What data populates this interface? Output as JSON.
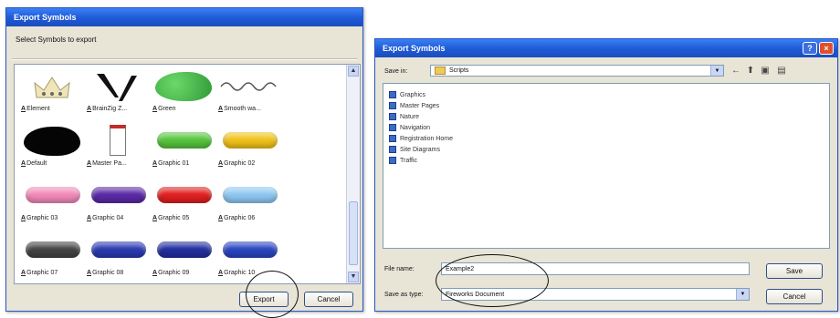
{
  "left_dialog": {
    "title": "Export Symbols",
    "subtitle": "Select Symbols to export",
    "symbols": [
      {
        "label": "Element",
        "thumb": "crown"
      },
      {
        "label": "BrainZig Z...",
        "thumb": "zigzag"
      },
      {
        "label": "Green",
        "thumb": "green-drop"
      },
      {
        "label": "Smooth wa...",
        "thumb": "smooth-wave"
      },
      {
        "label": "Default",
        "thumb": "black-drop"
      },
      {
        "label": "Master Pa...",
        "thumb": "master-page"
      },
      {
        "label": "Graphic 01",
        "thumb": "pill",
        "color": "#55c43c"
      },
      {
        "label": "Graphic 02",
        "thumb": "pill",
        "color": "#f0c21a"
      },
      {
        "label": "Graphic 03",
        "thumb": "pill",
        "color": "#f28ab8"
      },
      {
        "label": "Graphic 04",
        "thumb": "pill",
        "color": "#5a2aa6"
      },
      {
        "label": "Graphic 05",
        "thumb": "pill",
        "color": "#e02020"
      },
      {
        "label": "Graphic 06",
        "thumb": "pill",
        "color": "#8ec8f2"
      },
      {
        "label": "Graphic 07",
        "thumb": "pill",
        "color": "#444444"
      },
      {
        "label": "Graphic 08",
        "thumb": "pill",
        "color": "#2a3ab0"
      },
      {
        "label": "Graphic 09",
        "thumb": "pill",
        "color": "#23309e"
      },
      {
        "label": "Graphic 10",
        "thumb": "pill",
        "color": "#2a46c0"
      }
    ],
    "export_button": "Export",
    "cancel_button": "Cancel"
  },
  "right_dialog": {
    "title": "Export Symbols",
    "help_button": "?",
    "close_button": "×",
    "save_in_label": "Save in:",
    "save_in_value": "Scripts",
    "folders": [
      "Graphics",
      "Master Pages",
      "Nature",
      "Navigation",
      "Registration Home",
      "Site Diagrams",
      "Traffic"
    ],
    "file_name_label": "File name:",
    "file_name_value": "Example2",
    "save_as_type_label": "Save as type:",
    "save_as_type_value": "Fireworks Document",
    "save_button": "Save",
    "cancel_button": "Cancel"
  }
}
